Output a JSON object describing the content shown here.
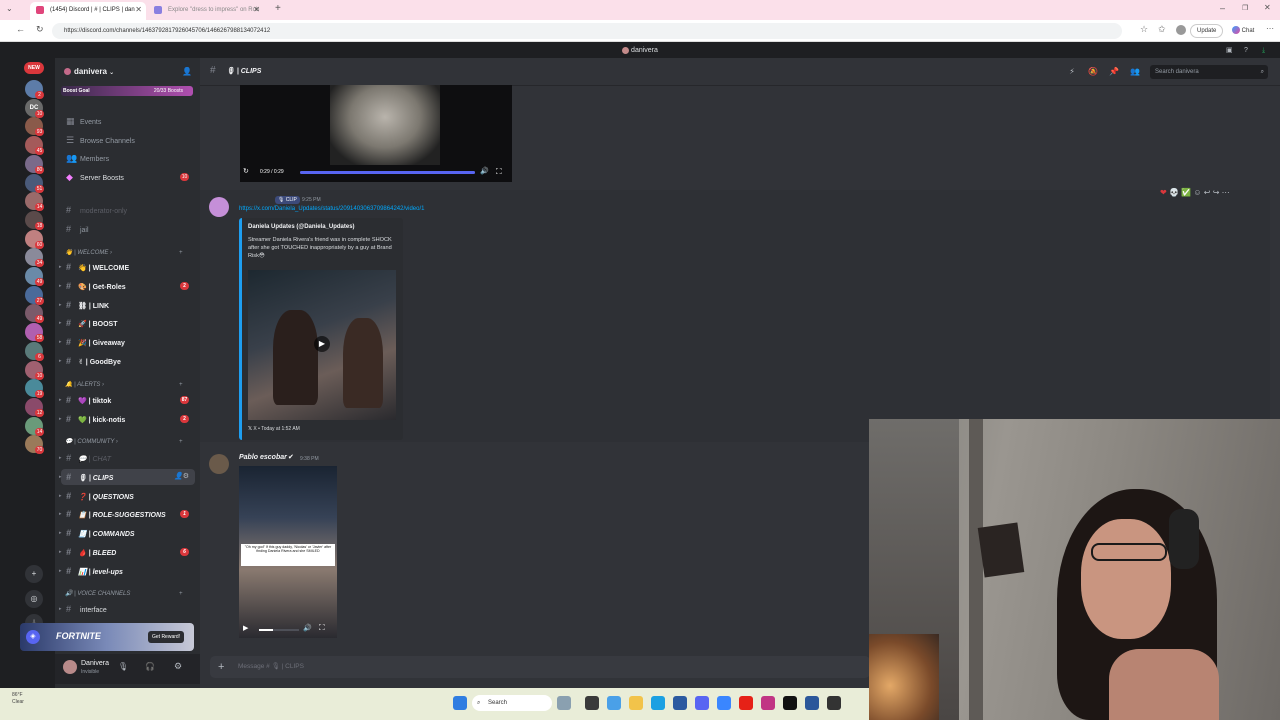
{
  "browser": {
    "tabs": [
      {
        "label": "(1454) Discord | # | CLIPS | dan"
      },
      {
        "label": "Explore \"dress to impress\" on Rob"
      }
    ],
    "url": "https://discord.com/channels/1463792817926045706/1466267988134072412",
    "update_label": "Update",
    "chat_label": "Chat"
  },
  "window_title": "danivera",
  "rail": {
    "new_label": "NEW",
    "servers": [
      {
        "badge": "2"
      },
      {
        "label": "DC",
        "badge": "10"
      },
      {
        "badge": "93"
      },
      {
        "badge": "45"
      },
      {
        "badge": "80"
      },
      {
        "badge": "51"
      },
      {
        "badge": "14"
      },
      {
        "badge": "18"
      },
      {
        "badge": "60"
      },
      {
        "badge": "34"
      },
      {
        "badge": "49"
      },
      {
        "badge": "27"
      },
      {
        "badge": "49"
      },
      {
        "badge": "58"
      },
      {
        "badge": "6"
      },
      {
        "badge": "10"
      },
      {
        "badge": "19"
      },
      {
        "badge": "12"
      },
      {
        "badge": "14"
      },
      {
        "badge": "70"
      }
    ]
  },
  "sidebar": {
    "server_name": "danivera",
    "boost_label": "Boost Goal",
    "boost_progress": "20/33 Boosts",
    "boost_fraction": 0.61,
    "top_items": [
      "Events",
      "Browse Channels",
      "Members",
      "Server Boosts"
    ],
    "server_boosts_badge": "10",
    "channels_a": [
      {
        "label": "moderator-only"
      },
      {
        "label": "jail"
      }
    ],
    "categories": {
      "welcome": "WELCOME",
      "alerts": "ALERTS",
      "community": "COMMUNITY",
      "voice": "VOICE CHANNELS"
    },
    "welcome_channels": [
      {
        "label": "WELCOME",
        "emoji": "👋",
        "badge": ""
      },
      {
        "label": "Get-Roles",
        "emoji": "🎨",
        "badge": "2"
      },
      {
        "label": "LINK",
        "emoji": "⛓",
        "badge": ""
      },
      {
        "label": "BOOST",
        "emoji": "🚀",
        "badge": ""
      },
      {
        "label": "Giveaway",
        "emoji": "🎉",
        "badge": ""
      },
      {
        "label": "GoodBye",
        "emoji": "✌",
        "badge": ""
      }
    ],
    "alert_channels": [
      {
        "label": "tiktok",
        "emoji": "💜",
        "badge": "87"
      },
      {
        "label": "kick-notis",
        "emoji": "💚",
        "badge": "2"
      }
    ],
    "community_channels": [
      {
        "label": "CHAT",
        "emoji": "💬",
        "badge": ""
      },
      {
        "label": "CLIPS",
        "emoji": "🎙",
        "badge": ""
      },
      {
        "label": "QUESTIONS",
        "emoji": "❓",
        "badge": ""
      },
      {
        "label": "ROLE-SUGGESTIONS",
        "emoji": "📋",
        "badge": "1"
      },
      {
        "label": "COMMANDS",
        "emoji": "🧾",
        "badge": ""
      },
      {
        "label": "BLEED",
        "emoji": "🩸",
        "badge": "6"
      },
      {
        "label": "level-ups",
        "emoji": "📊",
        "badge": ""
      }
    ],
    "voice_channels": [
      {
        "label": "interface"
      }
    ],
    "promo": {
      "title": "FORTNITE",
      "button": "Get Reward!"
    },
    "user": {
      "name": "Danivera",
      "status": "Invisible"
    }
  },
  "main": {
    "channel_name": "CLIPS",
    "search_placeholder": "Search danivera",
    "video1": {
      "time": "0:29 / 0:29",
      "progress": 1.0
    },
    "message1": {
      "tag": "CLIP",
      "time": "9:25 PM",
      "link": "https://x.com/Daniela_Updates/status/2091403063709864242/video/1",
      "embed_author": "Daniela Updates (@Daniela_Updates)",
      "embed_text": "Streamer Daniela Rivera's friend was in complete SHOCK after she got TOUCHED inappropriately by a guy at Brand Risk😳",
      "embed_footer": "X • Today at 1:52 AM"
    },
    "message2": {
      "author": "Pablo escobar",
      "time": "9:38 PM",
      "caption": "\"Oh my god\" If this guy daddy, 'Nicolas' or 'Javier' after finding Daniela Rivera and she SMILED",
      "video_progress": 0.35
    },
    "composer_placeholder": "Message # 🎙 | CLIPS"
  },
  "taskbar": {
    "weather_temp": "86°F",
    "weather_desc": "Clear",
    "search_label": "Search"
  },
  "colors": {
    "accent": "#5865f2",
    "badge_red": "#da373c",
    "link": "#00a8fc",
    "embed_border": "#1e9ef0"
  }
}
